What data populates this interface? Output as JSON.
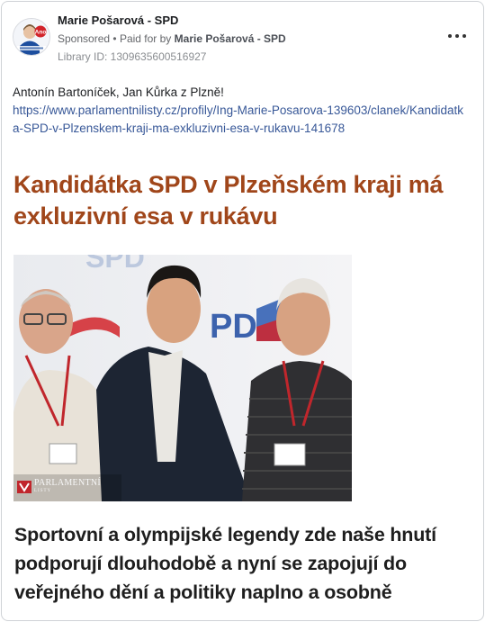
{
  "post": {
    "page_name": "Marie Pošarová - SPD",
    "sponsored_label": "Sponsored",
    "paid_for_prefix": "Paid for by",
    "paid_for_name": "Marie Pošarová - SPD",
    "library_id": "Library ID: 1309635600516927",
    "avatar_badge": "Ano",
    "caption_text": "Antonín Bartoníček, Jan Kůrka z Plzně!",
    "caption_link": "https://www.parlamentnilisty.cz/profily/Ing-Marie-Posarova-139603/clanek/Kandidatka-SPD-v-Plzenskem-kraji-ma-exkluzivni-esa-v-rukavu-141678",
    "headline": "Kandidátka SPD v Plzeňském kraji má exkluzivní esa v rukávu",
    "subheadline": "Sportovní a olympijské legendy zde naše hnutí podporují dlouhodobě a nyní se zapojují do veřejného dění a politiky naplno a osobně"
  },
  "photo": {
    "backdrop_text_top": "SPD",
    "backdrop_text_side": "PD",
    "logo_text": "PARLAMENTNÍ",
    "logo_subtext": "LISTY"
  },
  "icons": {
    "more": "more-options-icon",
    "logo": "parlamentni-listy-logo-icon"
  },
  "colors": {
    "headline": "#a0461a",
    "link": "#385898",
    "muted": "#65676b",
    "spd_blue": "#1d4e9e",
    "spd_red": "#d2232a"
  }
}
